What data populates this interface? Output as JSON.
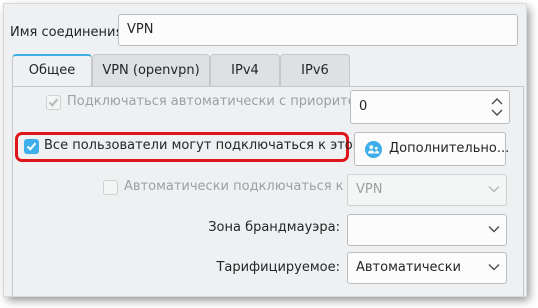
{
  "connection": {
    "name_label": "Имя соединения:",
    "name_value": "VPN"
  },
  "tabs": [
    {
      "label": "Общее",
      "active": true
    },
    {
      "label": "VPN (openvpn)",
      "active": false
    },
    {
      "label": "IPv4",
      "active": false
    },
    {
      "label": "IPv6",
      "active": false
    }
  ],
  "general": {
    "auto_connect_label": "Подключаться автоматически с приоритетом:",
    "priority_value": "0",
    "all_users_label": "Все пользователи могут подключаться к этой сети",
    "advanced_button_label": "Дополнительно...",
    "auto_vpn_label": "Автоматически подключаться к VPN:",
    "auto_vpn_value": "VPN",
    "firewall_label": "Зона брандмауэра:",
    "firewall_value": "",
    "metered_label": "Тарифицируемое:",
    "metered_value": "Автоматически"
  },
  "colors": {
    "accent": "#3daee9",
    "highlight": "#e0141b"
  },
  "icons": {
    "advanced_button_icon": "users-settings-icon",
    "priority_spin": "spin-up-down-icon",
    "dropdown": "chevron-down-icon"
  }
}
